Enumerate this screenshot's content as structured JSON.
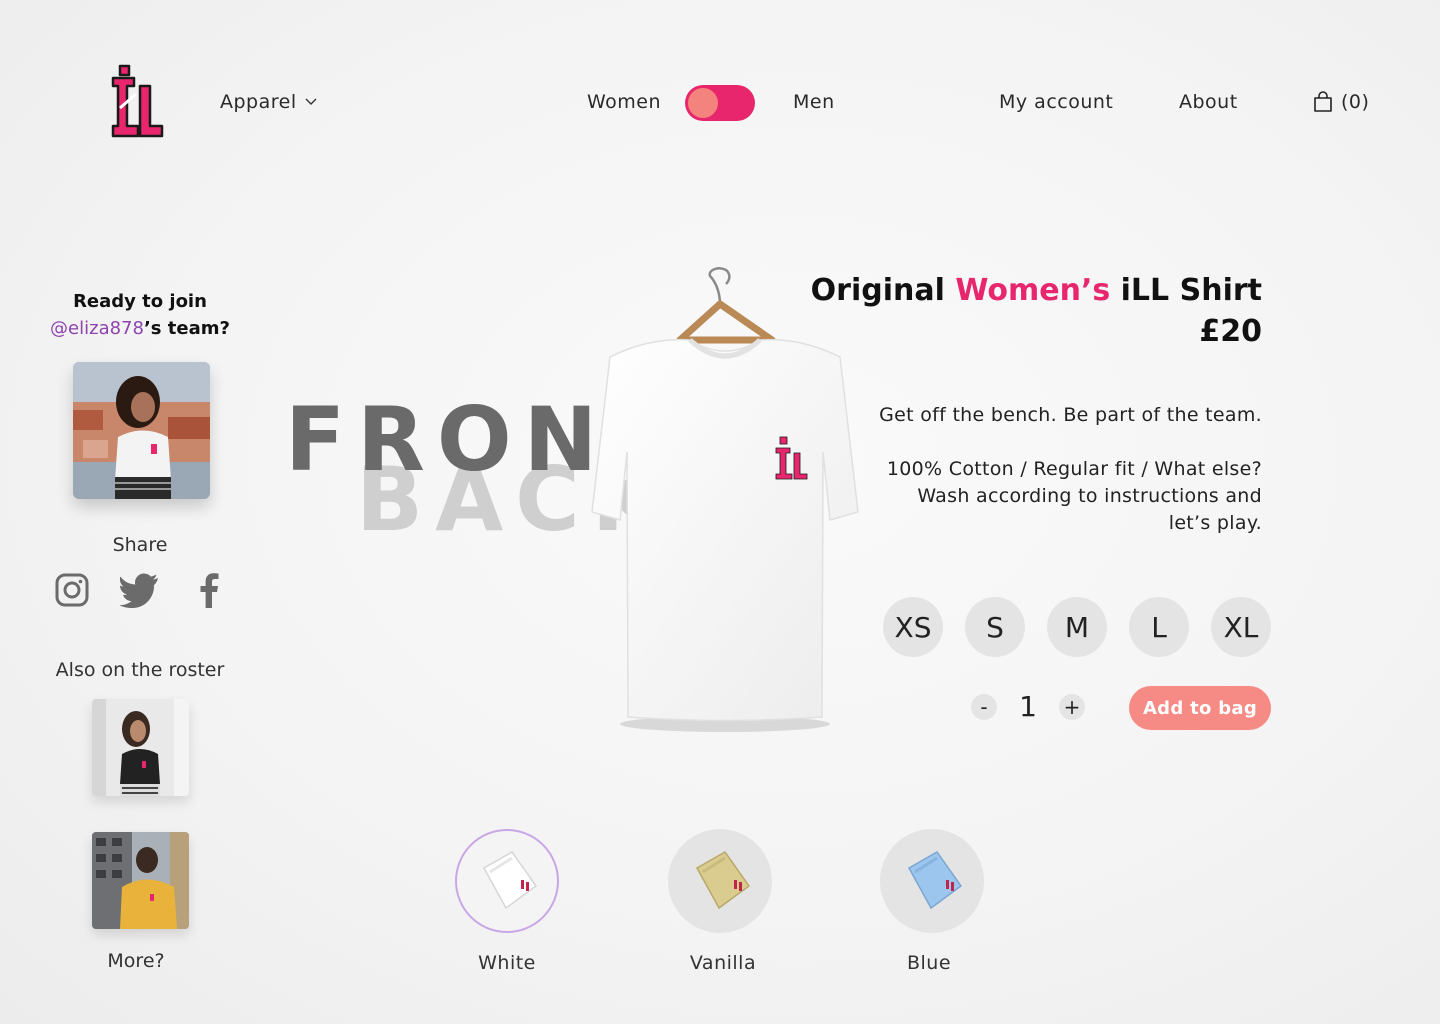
{
  "header": {
    "apparel_label": "Apparel",
    "women_label": "Women",
    "men_label": "Men",
    "gender_toggle_selected": "Women",
    "account_label": "My account",
    "about_label": "About",
    "cart_count": "(0)"
  },
  "sidebar": {
    "ready_line1": "Ready to join",
    "handle": "@eliza878",
    "ready_line2_suffix": "’s team?",
    "share_label": "Share",
    "social_icons": [
      "instagram-icon",
      "twitter-icon",
      "facebook-icon"
    ],
    "roster_label": "Also on the roster",
    "more_label": "More?"
  },
  "view": {
    "front_label": "FRONT",
    "back_label": "BACK"
  },
  "product": {
    "title_prefix": "Original ",
    "title_accent": "Women’s",
    "title_suffix": " iLL Shirt",
    "price": "£20",
    "tagline": "Get off the bench. Be part of the team.",
    "details_line1": "100% Cotton / Regular fit / What else?",
    "details_line2": "Wash according to instructions and",
    "details_line3": "let’s play.",
    "sizes": [
      "XS",
      "S",
      "M",
      "L",
      "XL"
    ],
    "quantity": "1",
    "minus_label": "-",
    "plus_label": "+",
    "add_to_bag_label": "Add to bag"
  },
  "colors": {
    "accent": "#e8266d",
    "button": "#f68b85",
    "handle": "#8e44ad",
    "swatches": [
      {
        "label": "White",
        "color": "#ffffff",
        "selected": true
      },
      {
        "label": "Vanilla",
        "color": "#d9cc8e",
        "selected": false
      },
      {
        "label": "Blue",
        "color": "#9cc6ee",
        "selected": false
      }
    ]
  }
}
